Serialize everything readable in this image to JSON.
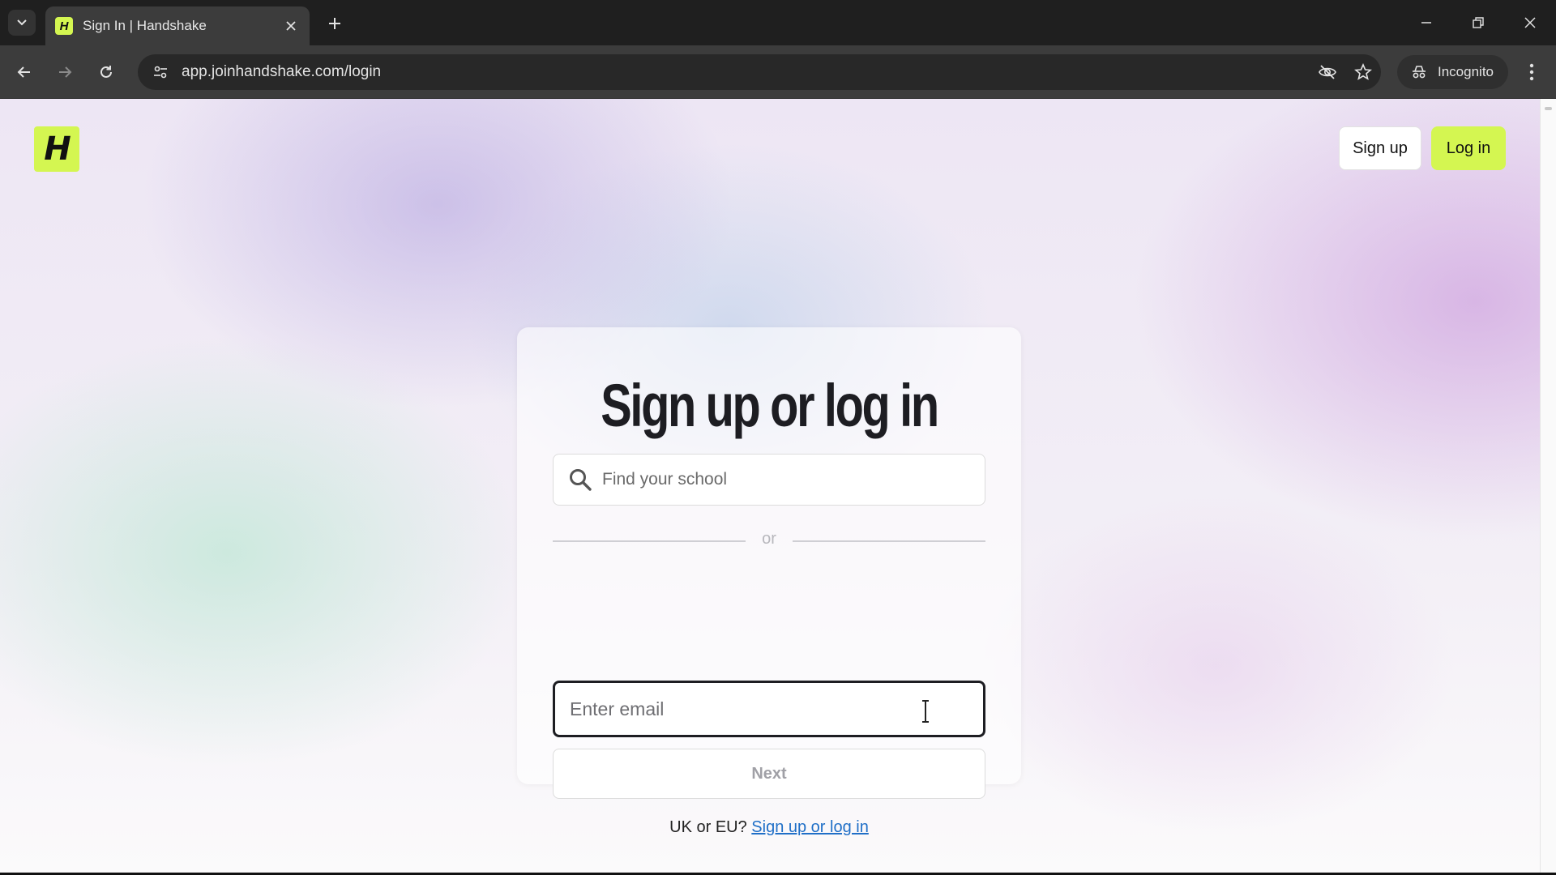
{
  "browser": {
    "tab_title": "Sign In | Handshake",
    "favicon_letter": "H",
    "url": "app.joinhandshake.com/login",
    "incognito_label": "Incognito"
  },
  "header": {
    "logo_letter": "H",
    "signup_label": "Sign up",
    "login_label": "Log in",
    "login_color": "#d4f651"
  },
  "card": {
    "title": "Sign up or log in",
    "school_search_placeholder": "Find your school",
    "divider_text": "or",
    "email_placeholder": "Enter email",
    "next_label": "Next",
    "region_prompt": "UK or EU?",
    "region_link": "Sign up or log in"
  }
}
